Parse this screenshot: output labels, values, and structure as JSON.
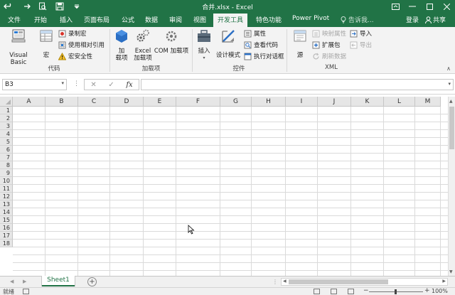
{
  "app": {
    "title": "合并.xlsx - Excel"
  },
  "colors": {
    "brand": "#217346",
    "ribbon_bg": "#f3f3f3"
  },
  "quick_access": {
    "undo_icon": "undo-icon",
    "redo_icon": "redo-icon",
    "preview_icon": "print-preview-icon",
    "save_icon": "save-icon",
    "customize_icon": "customize-qat-icon"
  },
  "tabs": [
    {
      "label": "文件"
    },
    {
      "label": "开始"
    },
    {
      "label": "插入"
    },
    {
      "label": "页面布局"
    },
    {
      "label": "公式"
    },
    {
      "label": "数据"
    },
    {
      "label": "审阅"
    },
    {
      "label": "视图"
    },
    {
      "label": "开发工具"
    },
    {
      "label": "特色功能"
    },
    {
      "label": "Power Pivot"
    }
  ],
  "active_tab": "开发工具",
  "tell_me": "告诉我...",
  "login": "登录",
  "share": "共享",
  "ribbon": {
    "code": {
      "label": "代码",
      "visual_basic": "Visual Basic",
      "macros": "宏",
      "record_macro": "录制宏",
      "relative_refs": "使用相对引用",
      "macro_security": "宏安全性"
    },
    "addins": {
      "label": "加载项",
      "addins_line1": "加",
      "addins_line2": "载项",
      "excel_addins_line1": "Excel",
      "excel_addins_line2": "加载项",
      "com_addins": "COM 加载项"
    },
    "controls": {
      "label": "控件",
      "insert": "插入",
      "design_mode": "设计模式",
      "properties": "属性",
      "view_code": "查看代码",
      "run_dialog": "执行对话框"
    },
    "xml": {
      "label": "XML",
      "source": "源",
      "map_properties": "映射属性",
      "expansion_packs": "扩展包",
      "refresh_data": "刷新数据",
      "import": "导入",
      "export": "导出"
    }
  },
  "formula_bar": {
    "name_box": "B3",
    "fx": "fx",
    "formula": ""
  },
  "grid": {
    "columns": [
      "A",
      "B",
      "C",
      "D",
      "E",
      "F",
      "G",
      "H",
      "I",
      "J",
      "K",
      "L",
      "M"
    ],
    "rows": [
      "1",
      "2",
      "3",
      "4",
      "5",
      "6",
      "7",
      "8",
      "9",
      "10",
      "11",
      "12",
      "13",
      "14",
      "15",
      "16",
      "17",
      "18"
    ]
  },
  "sheets": [
    {
      "name": "Sheet1",
      "active": true
    }
  ],
  "status": {
    "ready": "就绪",
    "zoom_minus": "−",
    "zoom_plus": "+",
    "zoom": "100%"
  }
}
